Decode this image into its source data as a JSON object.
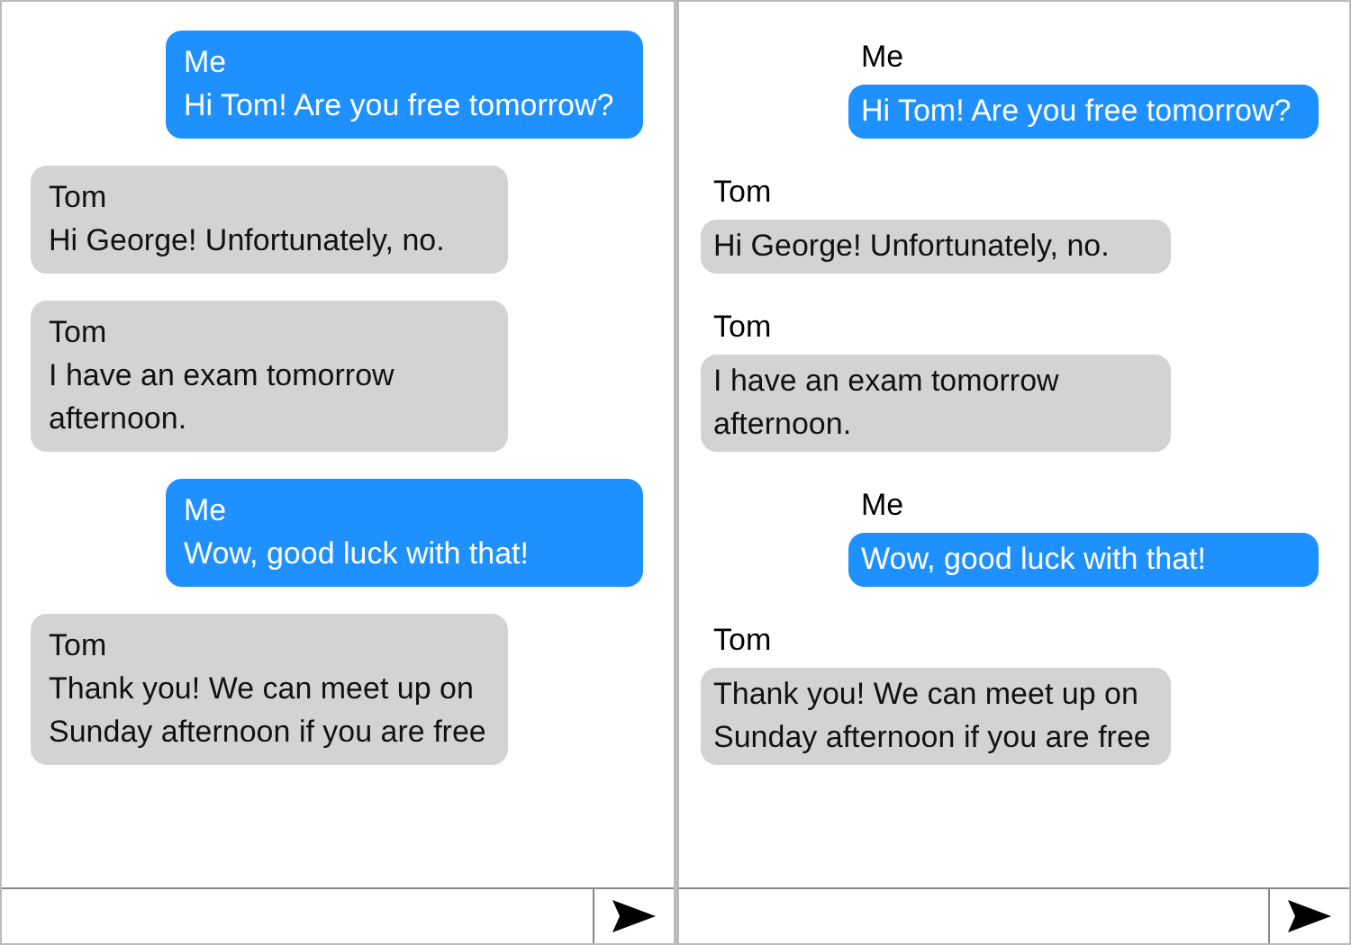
{
  "panels": [
    {
      "kind": "inside",
      "messages": [
        {
          "sender": "Me",
          "text": "Hi Tom! Are you free tomorrow?",
          "mine": true
        },
        {
          "sender": "Tom",
          "text": "Hi George! Unfortunately, no.",
          "mine": false
        },
        {
          "sender": "Tom",
          "text": "I have an exam tomorrow afternoon.",
          "mine": false
        },
        {
          "sender": "Me",
          "text": "Wow, good luck with that!",
          "mine": true
        },
        {
          "sender": "Tom",
          "text": "Thank you! We can meet up on Sunday afternoon if you are free",
          "mine": false
        }
      ]
    },
    {
      "kind": "above",
      "messages": [
        {
          "sender": "Me",
          "text": "Hi Tom! Are you free tomorrow?",
          "mine": true
        },
        {
          "sender": "Tom",
          "text": "Hi George! Unfortunately, no.",
          "mine": false
        },
        {
          "sender": "Tom",
          "text": "I have an exam tomorrow afternoon.",
          "mine": false
        },
        {
          "sender": "Me",
          "text": "Wow, good luck with that!",
          "mine": true
        },
        {
          "sender": "Tom",
          "text": "Thank you! We can meet up on Sunday afternoon if you are free",
          "mine": false
        }
      ]
    }
  ]
}
